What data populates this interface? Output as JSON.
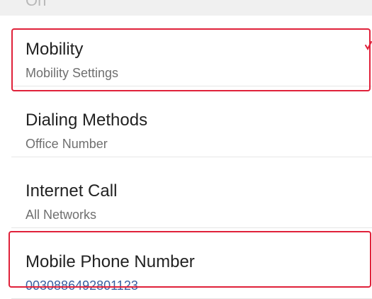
{
  "header": {
    "partial_text": "On"
  },
  "settings": {
    "items": [
      {
        "title": "Mobility",
        "subtitle": "Mobility Settings"
      },
      {
        "title": "Dialing Methods",
        "subtitle": "Office Number"
      },
      {
        "title": "Internet Call",
        "subtitle": "All Networks"
      },
      {
        "title": "Mobile Phone Number",
        "subtitle": "0030886492801123"
      }
    ]
  },
  "colors": {
    "highlight": "#e0213a",
    "link": "#3a5fa0"
  }
}
